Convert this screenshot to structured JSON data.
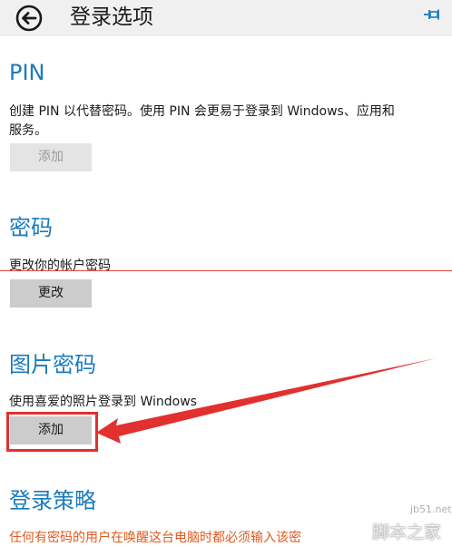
{
  "header": {
    "title": "登录选项"
  },
  "sections": {
    "pin": {
      "title": "PIN",
      "description_line1": "创建 PIN 以代替密码。使用 PIN 会更易于登录到 Windows、应用和",
      "description_line2": "服务。",
      "button_label": "添加"
    },
    "password": {
      "title": "密码",
      "description": "更改你的帐户密码",
      "button_label": "更改"
    },
    "picture_password": {
      "title": "图片密码",
      "description": "使用喜爱的照片登录到 Windows",
      "button_label": "添加"
    },
    "signin_policy": {
      "title": "登录策略",
      "description": "任何有密码的用户在唤醒这台电脑时都必须输入该密"
    }
  },
  "watermark": {
    "site": "jb51.net",
    "brand": "脚本之家"
  },
  "colors": {
    "accent": "#1a7bbf",
    "annotation_red": "#e2302e",
    "policy_text": "#e05a1e"
  }
}
